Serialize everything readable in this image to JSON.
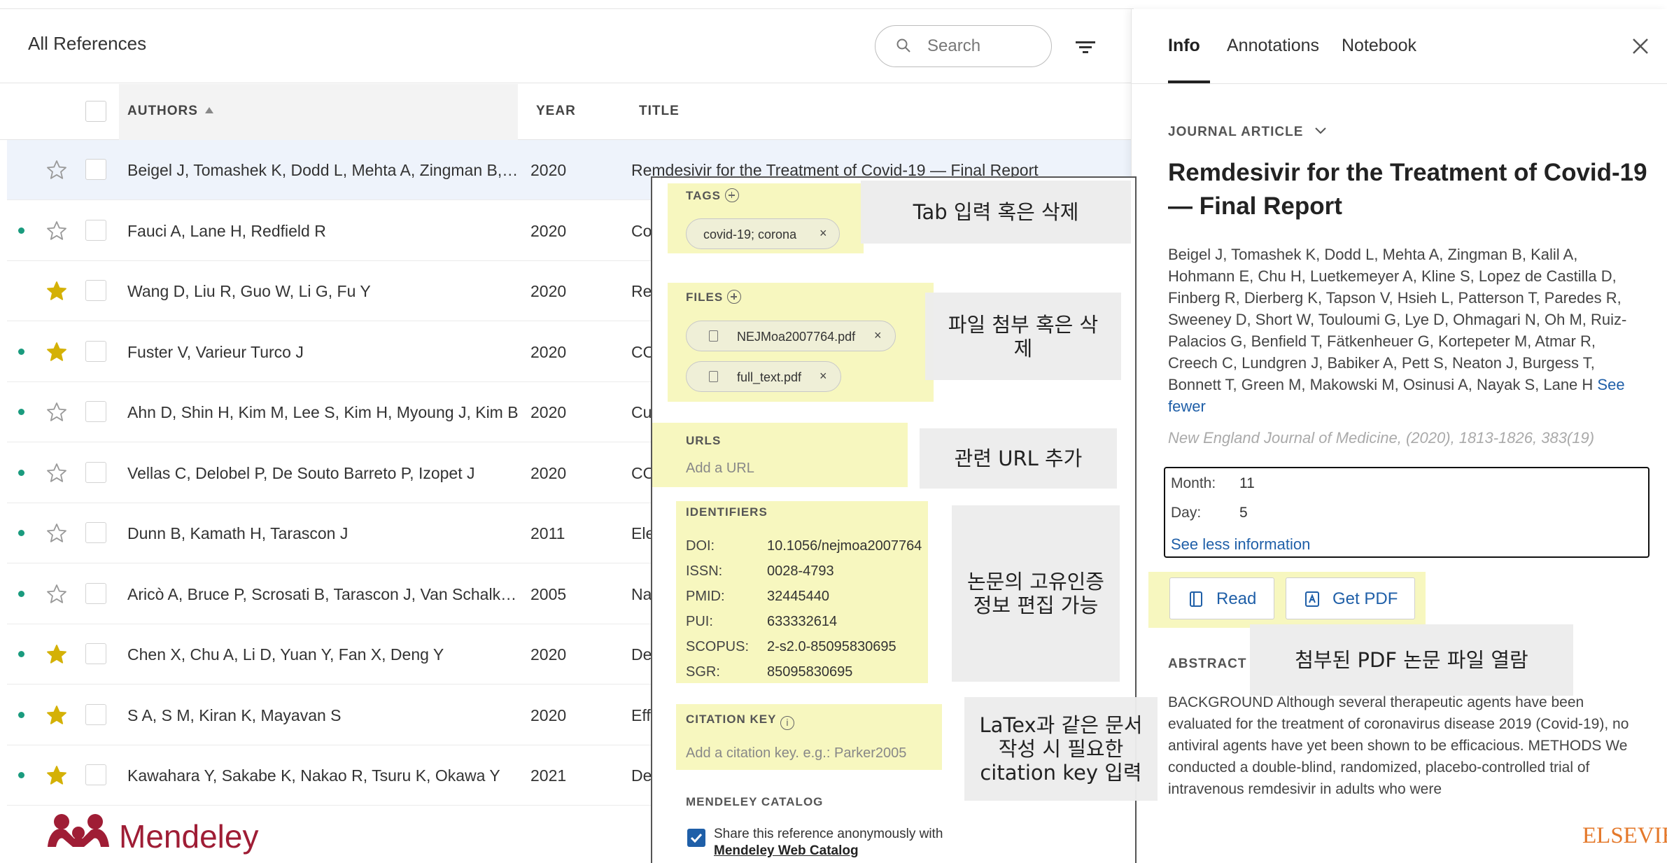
{
  "list": {
    "title": "All References",
    "search_placeholder": "Search",
    "columns": {
      "authors": "AUTHORS",
      "year": "YEAR",
      "title": "TITLE"
    },
    "rows": [
      {
        "authors": "Beigel J, Tomashek K, Dodd L, Mehta A, Zingman B, Kalil A",
        "year": "2020",
        "title": "Remdesivir for the Treatment of Covid-19 — Final Report",
        "starred": false,
        "unread": false,
        "selected": true
      },
      {
        "authors": "Fauci A, Lane H, Redfield R",
        "year": "2020",
        "title": "Co",
        "starred": false,
        "unread": true,
        "selected": false
      },
      {
        "authors": "Wang D, Liu R, Guo W, Li G, Fu Y",
        "year": "2020",
        "title": "Re",
        "starred": true,
        "unread": false,
        "selected": false
      },
      {
        "authors": "Fuster V, Varieur Turco J",
        "year": "2020",
        "title": "CO",
        "starred": true,
        "unread": true,
        "selected": false
      },
      {
        "authors": "Ahn D, Shin H, Kim M, Lee S, Kim H, Myoung J, Kim B",
        "year": "2020",
        "title": "Cu",
        "starred": false,
        "unread": true,
        "selected": false
      },
      {
        "authors": "Vellas C, Delobel P, De Souto Barreto P, Izopet J",
        "year": "2020",
        "title": "CO",
        "starred": false,
        "unread": true,
        "selected": false
      },
      {
        "authors": "Dunn B, Kamath H, Tarascon J",
        "year": "2011",
        "title": "Ele",
        "starred": false,
        "unread": true,
        "selected": false
      },
      {
        "authors": "Aricò A, Bruce P, Scrosati B, Tarascon J, Van Schalkwijk W",
        "year": "2005",
        "title": "Na",
        "starred": false,
        "unread": true,
        "selected": false
      },
      {
        "authors": "Chen X, Chu A, Li D, Yuan Y, Fan X, Deng Y",
        "year": "2020",
        "title": "De",
        "starred": true,
        "unread": true,
        "selected": false
      },
      {
        "authors": "S A, S M, Kiran K, Mayavan S",
        "year": "2020",
        "title": "Eff",
        "starred": true,
        "unread": true,
        "selected": false
      },
      {
        "authors": "Kawahara Y, Sakabe K, Nakao R, Tsuru K, Okawa Y",
        "year": "2021",
        "title": "De",
        "starred": true,
        "unread": true,
        "selected": false
      }
    ],
    "logo_text": "Mendeley"
  },
  "panel": {
    "tabs": [
      "Info",
      "Annotations",
      "Notebook"
    ],
    "doc_type": "JOURNAL ARTICLE",
    "title": "Remdesivir for the Treatment of Covid-19 — Final Report",
    "authors": "Beigel J, Tomashek K, Dodd L, Mehta A, Zingman B, Kalil A, Hohmann E, Chu H, Luetkemeyer A, Kline S, Lopez de Castilla D, Finberg R, Dierberg K, Tapson V, Hsieh L, Patterson T, Paredes R, Sweeney D, Short W, Touloumi G, Lye D, Ohmagari N, Oh M, Ruiz-Palacios G, Benfield T, Fätkenheuer G, Kortepeter M, Atmar R, Creech C, Lundgren J, Babiker A, Pett S, Neaton J, Burgess T, Bonnett T, Green M, Makowski M, Osinusi A, Nayak S, Lane H",
    "see_fewer": "See fewer",
    "journal": "New England Journal of Medicine, (2020), 1813-1826, 383(19)",
    "month_label": "Month:",
    "month_value": "11",
    "day_label": "Day:",
    "day_value": "5",
    "see_less": "See less information",
    "read_label": "Read",
    "getpdf_label": "Get PDF",
    "abstract_head": "ABSTRACT",
    "abstract_text": "BACKGROUND Although several therapeutic agents have been evaluated for the treatment of coronavirus disease 2019 (Covid-19), no antiviral agents have yet been shown to be efficacious. METHODS We conducted a double-blind, randomized, placebo-controlled trial of intravenous remdesivir in adults who were",
    "publisher": "ELSEVIER"
  },
  "edit": {
    "tags_head": "TAGS",
    "tag_chip": "covid-19; corona",
    "files_head": "FILES",
    "files": [
      "NEJMoa2007764.pdf",
      "full_text.pdf"
    ],
    "urls_head": "URLS",
    "url_placeholder": "Add a URL",
    "identifiers_head": "IDENTIFIERS",
    "identifiers": [
      {
        "label": "DOI:",
        "value": "10.1056/nejmoa2007764"
      },
      {
        "label": "ISSN:",
        "value": "0028-4793"
      },
      {
        "label": "PMID:",
        "value": "32445440"
      },
      {
        "label": "PUI:",
        "value": "633332614"
      },
      {
        "label": "SCOPUS:",
        "value": "2-s2.0-85095830695"
      },
      {
        "label": "SGR:",
        "value": "85095830695"
      }
    ],
    "citation_head": "CITATION KEY",
    "citation_placeholder": "Add a citation key. e.g.: Parker2005",
    "catalog_head": "MENDELEY CATALOG",
    "share_text": "Share this reference anonymously with",
    "share_link": "Mendeley Web Catalog"
  },
  "callouts": {
    "tags": "Tab 입력 혹은 삭제",
    "files": "파일 첨부 혹은 삭제",
    "urls": "관련 URL 추가",
    "identifiers": "논문의 고유인증정보 편집 가능",
    "citation": "LaTex과 같은 문서 작성 시 필요한 citation key 입력",
    "pdf": "첨부된 PDF 논문 파일 열람"
  },
  "colors": {
    "accent": "#1f5fa8",
    "unread_dot": "#1a9b7e",
    "star": "#d4b106",
    "highlight": "#f6f6b4",
    "brand": "#9f1d35"
  }
}
